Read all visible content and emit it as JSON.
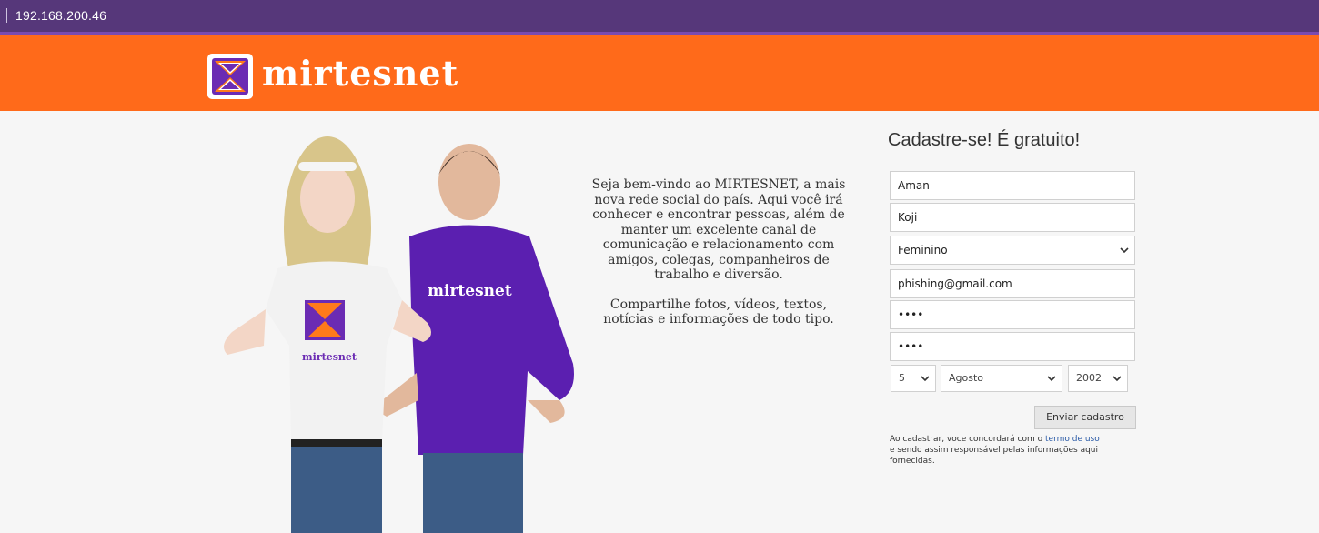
{
  "browser": {
    "address": "192.168.200.46"
  },
  "header": {
    "brand": "mirtesnet"
  },
  "hero": {
    "shirt_text_left": "mirtesnet",
    "shirt_text_right": "mirtesnet"
  },
  "intro": {
    "paragraph_1_lines": [
      "Seja bem-vindo ao MIRTESNET, a  mais",
      "nova rede social do país. Aqui você irá",
      "conhecer e encontrar  pessoas, além de",
      "manter um  excelente canal de",
      "comunicação e  relacionamento com",
      "amigos,  colegas, companheiros de",
      "trabalho e  diversão."
    ],
    "paragraph_2_lines": [
      "Compartilhe fotos, vídeos, textos,",
      "notícias e informações de todo tipo."
    ]
  },
  "form": {
    "title": "Cadastre-se! É gratuito!",
    "first_name": "Aman",
    "last_name": "Koji",
    "gender": "Feminino",
    "email": "phishing@gmail.com",
    "password": "••••",
    "password_confirm": "••••",
    "birth_day": "5",
    "birth_month": "Agosto",
    "birth_year": "2002",
    "submit_label": "Enviar cadastro",
    "terms_prefix": "Ao cadastrar, voce concordará com o ",
    "terms_link": "termo de uso",
    "terms_suffix": "e sendo assim responsável pelas informações aqui fornecidas."
  },
  "colors": {
    "browser_bar": "#56377a",
    "header_orange": "#ff6a1a",
    "brand_purple": "#6b2bb3"
  }
}
